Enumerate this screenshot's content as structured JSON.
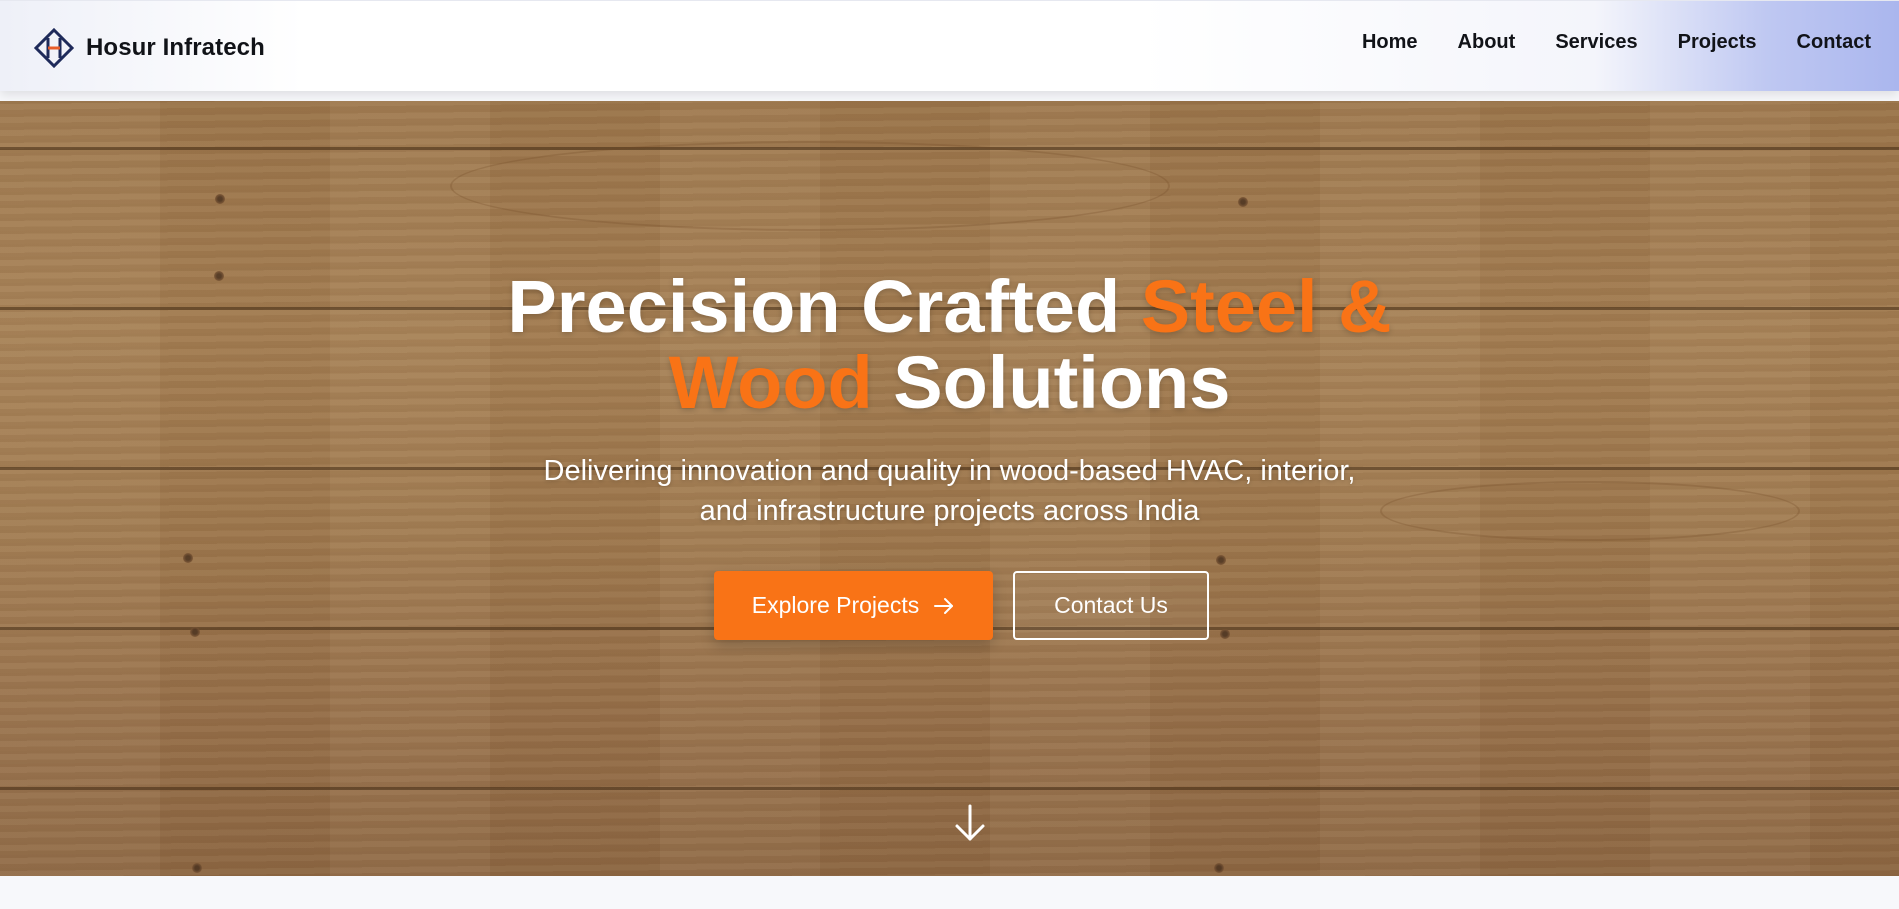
{
  "header": {
    "brand_name": "Hosur Infratech",
    "logo_icon": "hi-diamond-logo-icon",
    "nav": [
      {
        "label": "Home"
      },
      {
        "label": "About"
      },
      {
        "label": "Services"
      },
      {
        "label": "Projects"
      },
      {
        "label": "Contact"
      }
    ]
  },
  "hero": {
    "title_part1": "Precision Crafted ",
    "title_accent1": "Steel &",
    "title_accent2": "Wood",
    "title_part2": " Solutions",
    "subtitle_line1": "Delivering innovation and quality in wood-based HVAC, interior,",
    "subtitle_line2": "and infrastructure projects across India",
    "primary_button": "Explore Projects",
    "primary_button_icon": "arrow-right-icon",
    "secondary_button": "Contact Us",
    "scroll_icon": "arrow-down-icon"
  },
  "colors": {
    "accent": "#f97316",
    "text_light": "#ffffff",
    "text_dark": "#111318",
    "logo_navy": "#1e2a5a"
  }
}
